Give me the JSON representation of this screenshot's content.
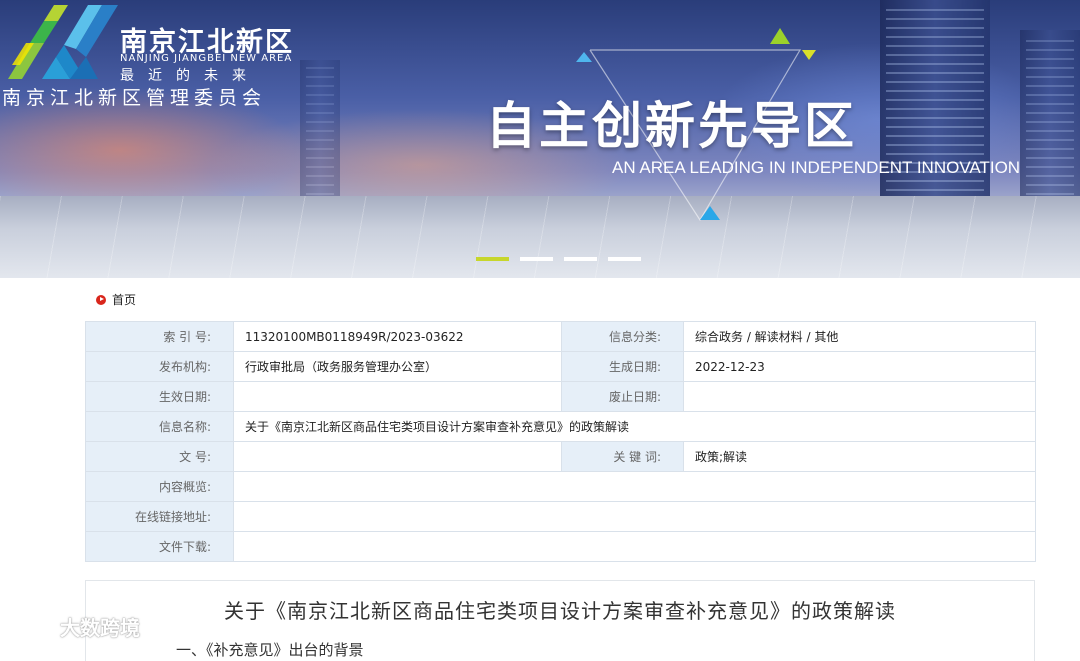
{
  "banner": {
    "logo_cn": "南京江北新区",
    "logo_en": "NANJING JIANGBEI NEW AREA",
    "logo_slogan": "最近的未来",
    "logo_org": "南京江北新区管理委员会",
    "headline": "自主创新先导区",
    "headline_en": "AN AREA LEADING IN INDEPENDENT INNOVATION",
    "slides_total": 4,
    "active_slide": 1,
    "accent_color": "#c7d62c"
  },
  "breadcrumb": {
    "home_label": "首页"
  },
  "info": {
    "index_label": "索 引 号:",
    "index_value": "11320100MB0118949R/2023-03622",
    "category_label": "信息分类:",
    "category_value": "综合政务 / 解读材料 / 其他",
    "publisher_label": "发布机构:",
    "publisher_value": "行政审批局（政务服务管理办公室）",
    "gen_date_label": "生成日期:",
    "gen_date_value": "2022-12-23",
    "effective_label": "生效日期:",
    "effective_value": "",
    "abolish_label": "废止日期:",
    "abolish_value": "",
    "name_label": "信息名称:",
    "name_value": "关于《南京江北新区商品住宅类项目设计方案审查补充意见》的政策解读",
    "doc_no_label": "文 号:",
    "doc_no_value": "",
    "keywords_label": "关 键 词:",
    "keywords_value": "政策;解读",
    "overview_label": "内容概览:",
    "overview_value": "",
    "link_label": "在线链接地址:",
    "link_value": "",
    "download_label": "文件下载:",
    "download_value": ""
  },
  "article": {
    "title": "关于《南京江北新区商品住宅类项目设计方案审查补充意见》的政策解读",
    "subtitle_partial": "一、《补充意见》出台的背景"
  },
  "watermark": {
    "text": "大数跨境"
  }
}
